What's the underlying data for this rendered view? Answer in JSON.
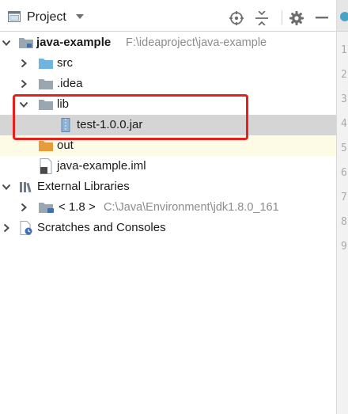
{
  "panel": {
    "title": "Project"
  },
  "toolbar": {
    "icons": [
      "project-view-icon",
      "dropdown-icon",
      "locate-icon",
      "collapse-all-icon",
      "settings-icon",
      "hide-icon"
    ]
  },
  "tree": {
    "root": {
      "name": "java-example",
      "path": "F:\\ideaproject\\java-example"
    },
    "src": "src",
    "idea": ".idea",
    "lib": "lib",
    "jar": "test-1.0.0.jar",
    "out": "out",
    "iml": "java-example.iml",
    "external": "External Libraries",
    "jdk": {
      "name": "< 1.8 >",
      "path": "C:\\Java\\Environment\\jdk1.8.0_161"
    },
    "scratches": "Scratches and Consoles"
  },
  "editor": {
    "line_numbers": [
      "1",
      "2",
      "3",
      "4",
      "5",
      "6",
      "7",
      "8",
      "9"
    ]
  },
  "colors": {
    "selection": "#d5d5d5",
    "highlight_box": "#e8201c",
    "folder_blue": "#6fb3e0",
    "folder_grey": "#9aa7b0",
    "out_row": "#fdfae6"
  }
}
